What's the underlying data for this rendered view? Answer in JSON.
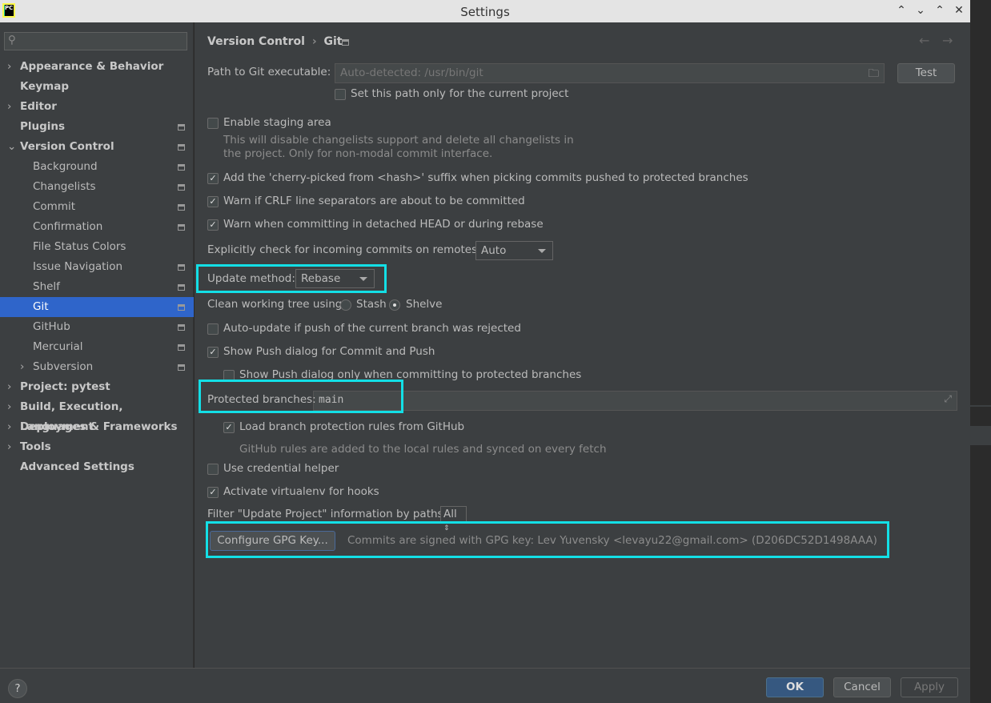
{
  "window": {
    "title": "Settings",
    "logo": "PC"
  },
  "search": {
    "placeholder": ""
  },
  "sidebar": {
    "items": [
      {
        "label": "Appearance & Behavior",
        "expandable": true
      },
      {
        "label": "Keymap"
      },
      {
        "label": "Editor",
        "expandable": true
      },
      {
        "label": "Plugins",
        "pinned": true
      },
      {
        "label": "Version Control",
        "expanded": true,
        "pinned": true
      },
      {
        "label": "Background",
        "child": true,
        "pinned": true
      },
      {
        "label": "Changelists",
        "child": true,
        "pinned": true
      },
      {
        "label": "Commit",
        "child": true,
        "pinned": true
      },
      {
        "label": "Confirmation",
        "child": true,
        "pinned": true
      },
      {
        "label": "File Status Colors",
        "child": true
      },
      {
        "label": "Issue Navigation",
        "child": true,
        "pinned": true
      },
      {
        "label": "Shelf",
        "child": true,
        "pinned": true
      },
      {
        "label": "Git",
        "child": true,
        "pinned": true,
        "selected": true
      },
      {
        "label": "GitHub",
        "child": true,
        "pinned": true
      },
      {
        "label": "Mercurial",
        "child": true,
        "pinned": true
      },
      {
        "label": "Subversion",
        "child": true,
        "pinned": true,
        "expandable": true
      },
      {
        "label": "Project: pytest",
        "expandable": true
      },
      {
        "label": "Build, Execution, Deployment",
        "expandable": true
      },
      {
        "label": "Languages & Frameworks",
        "expandable": true
      },
      {
        "label": "Tools",
        "expandable": true
      },
      {
        "label": "Advanced Settings"
      }
    ]
  },
  "breadcrumb": {
    "parent": "Version Control",
    "sep": "›",
    "current": "Git"
  },
  "git": {
    "path_label": "Path to Git executable:",
    "path_placeholder": "Auto-detected: /usr/bin/git",
    "test_button": "Test",
    "path_current_project": "Set this path only for the current project",
    "staging": "Enable staging area",
    "staging_hint1": "This will disable changelists support and delete all changelists in",
    "staging_hint2": "the project. Only for non-modal commit interface.",
    "cherry": "Add the 'cherry-picked from <hash>' suffix when picking commits pushed to protected branches",
    "crlf": "Warn if CRLF line separators are about to be committed",
    "detached": "Warn when committing in detached HEAD or during rebase",
    "incoming_label": "Explicitly check for incoming commits on remotes:",
    "incoming_value": "Auto",
    "update_label": "Update method:",
    "update_value": "Rebase",
    "clean_label": "Clean working tree using:",
    "stash": "Stash",
    "shelve": "Shelve",
    "autoupdate": "Auto-update if push of the current branch was rejected",
    "showpush": "Show Push dialog for Commit and Push",
    "showpush_protected": "Show Push dialog only when committing to protected branches",
    "protected_label": "Protected branches:",
    "protected_value": "main",
    "load_rules": "Load branch protection rules from GitHub",
    "load_rules_hint": "GitHub rules are added to the local rules and synced on every fetch",
    "credential": "Use credential helper",
    "virtualenv": "Activate virtualenv for hooks",
    "filter_label": "Filter \"Update Project\" information by paths:",
    "filter_value": "All",
    "gpg_button": "Configure GPG Key...",
    "gpg_info": "Commits are signed with GPG key: Lev Yuvensky <levayu22@gmail.com> (D206DC52D1498AAA)"
  },
  "checks": {
    "path_current_project": false,
    "staging": false,
    "cherry": true,
    "crlf": true,
    "detached": true,
    "autoupdate": false,
    "showpush": true,
    "showpush_protected": false,
    "load_rules": true,
    "credential": false,
    "virtualenv": true,
    "clean_tree": "Shelve"
  },
  "footer": {
    "help": "?",
    "ok": "OK",
    "cancel": "Cancel",
    "apply": "Apply"
  },
  "colors": {
    "selection": "#2f65ca",
    "highlight": "#13dfe6",
    "ok": "#365880"
  }
}
